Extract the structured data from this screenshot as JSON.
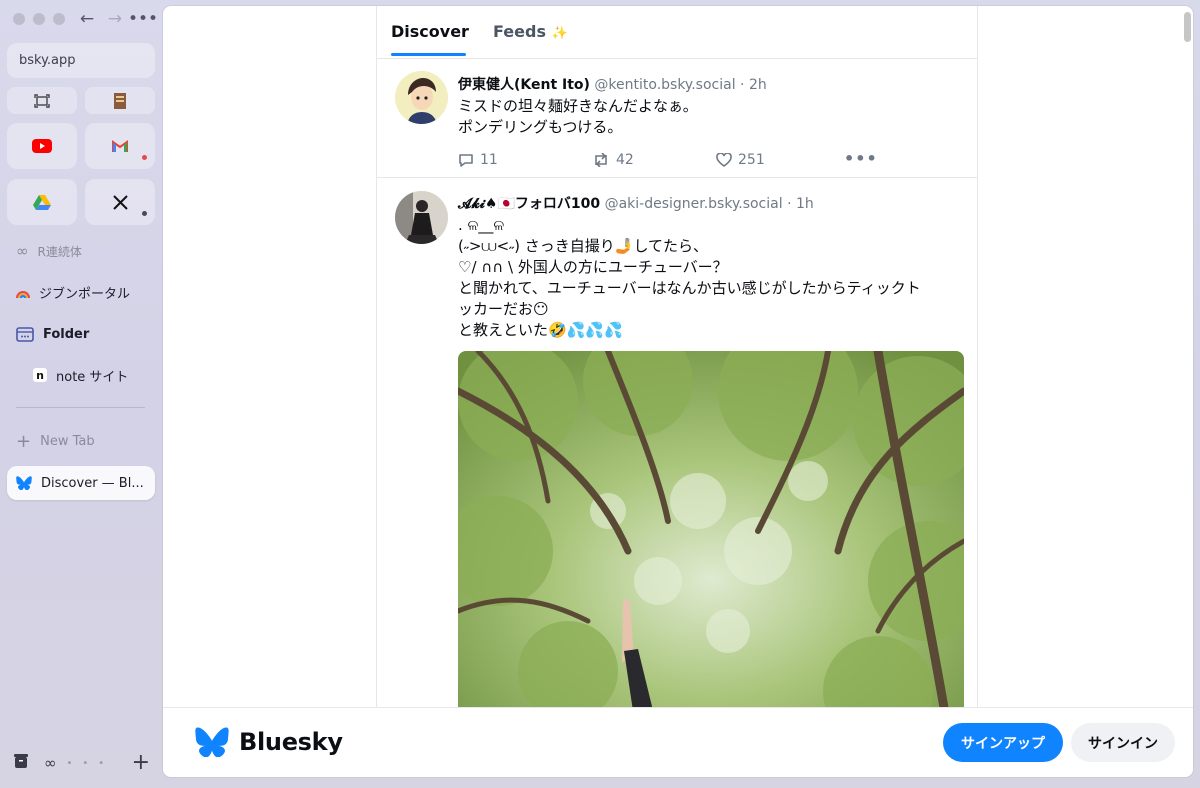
{
  "browser": {
    "url": "bsky.app",
    "pinned_small": [
      {
        "icon": "capture-icon"
      },
      {
        "icon": "book-icon"
      }
    ],
    "pinned_big": [
      {
        "icon": "youtube-icon"
      },
      {
        "icon": "gmail-icon"
      },
      {
        "icon": "google-drive-icon"
      },
      {
        "icon": "x-icon"
      }
    ],
    "sidebar_items": [
      {
        "label": "R連続体",
        "icon": "infinity-icon"
      },
      {
        "label": "ジブンポータル",
        "icon": "rainbow-icon"
      },
      {
        "label": "Folder",
        "icon": "folder-icon"
      },
      {
        "label": "note サイト",
        "icon": "note-icon"
      }
    ],
    "new_tab_label": "New Tab",
    "active_tab_label": "Discover — Bl...",
    "colors": {
      "accent": "#1083fe",
      "badge_red": "#e5484d"
    }
  },
  "feed": {
    "tabs": [
      {
        "label": "Discover",
        "active": true
      },
      {
        "label": "Feeds",
        "emoji": "✨",
        "active": false
      }
    ],
    "posts": [
      {
        "author_name": "伊東健人(Kent Ito)",
        "handle": "@kentito.bsky.social",
        "sep": " · ",
        "time": "2h",
        "lines": [
          "ミスドの坦々麺好きなんだよなぁ。",
          "ポンデリングもつける。"
        ],
        "replies": "11",
        "reposts": "42",
        "likes": "251"
      },
      {
        "author_name": "𝓐𝓴𝓲♠🇯🇵フォロバ100",
        "handle": "@aki-designer.bsky.social",
        "sep": " · ",
        "time": "1h",
        "lines": [
          ". ଳ__ଳ",
          "(˶>⩊<˶)  さっき自撮り🤳してたら、",
          "♡/ ∩∩ \\  外国人の方にユーチューバー？",
          "と聞かれて、ユーチューバーはなんか古い感じがしたからティックト",
          "ッカーだお😶",
          "と教えといた🤣💦💦💦"
        ]
      }
    ]
  },
  "footer": {
    "brand": "Bluesky",
    "signup_label": "サインアップ",
    "signin_label": "サインイン"
  }
}
